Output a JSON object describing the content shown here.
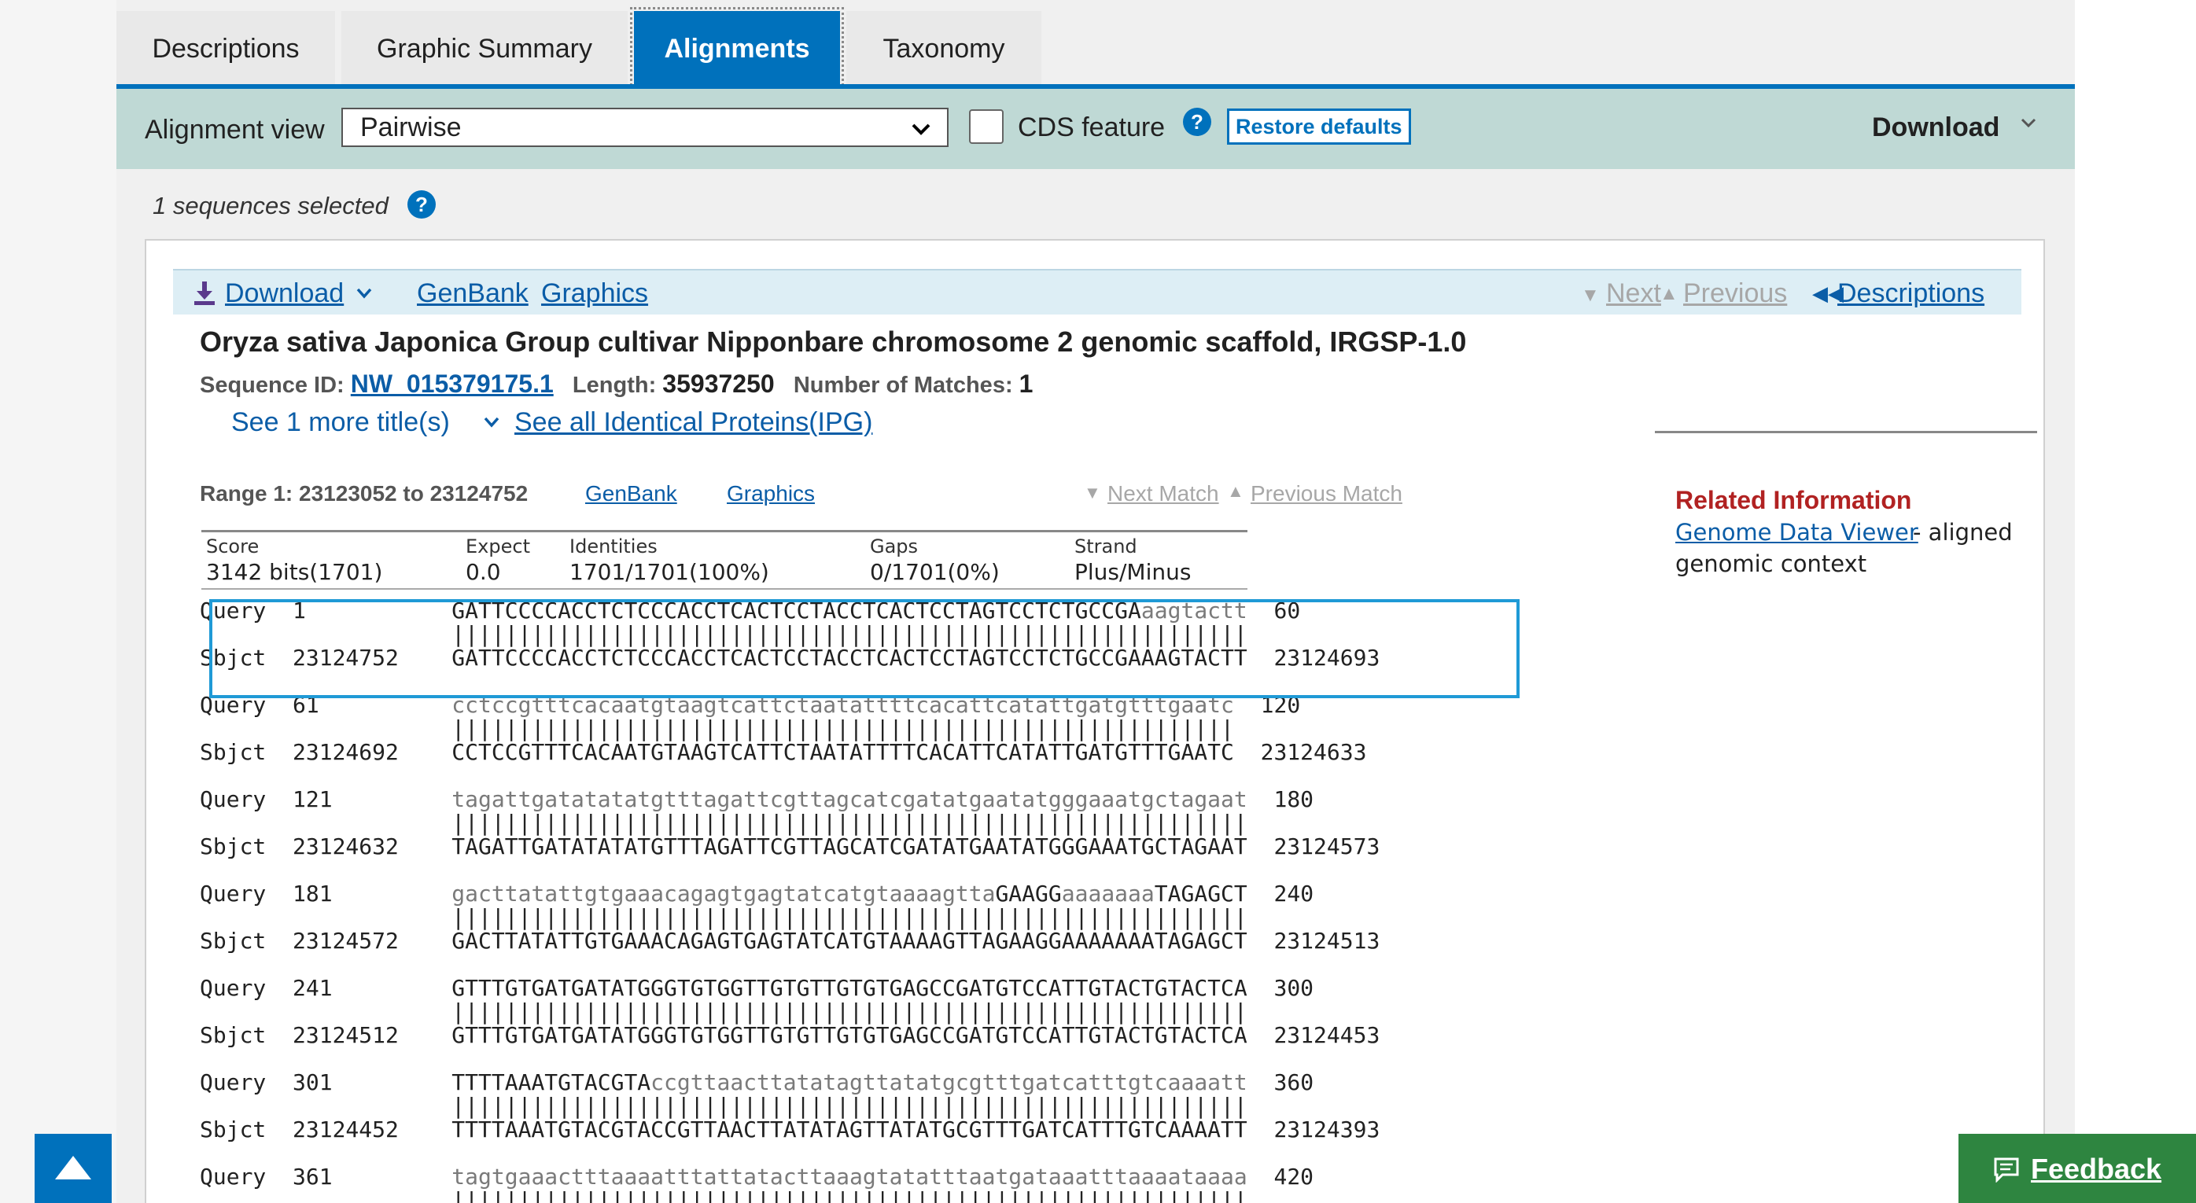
{
  "tabs": [
    {
      "label": "Descriptions"
    },
    {
      "label": "Graphic Summary"
    },
    {
      "label": "Alignments"
    },
    {
      "label": "Taxonomy"
    }
  ],
  "toolbar": {
    "alignment_view_label": "Alignment view",
    "alignment_view_value": "Pairwise",
    "cds_feature_label": "CDS feature",
    "restore_defaults_label": "Restore defaults",
    "download_label": "Download"
  },
  "selection": {
    "text": "1 sequences selected"
  },
  "panel_bar": {
    "download_label": "Download",
    "genbank_label": "GenBank",
    "graphics_label": "Graphics",
    "next_label": "Next",
    "previous_label": "Previous",
    "descriptions_label": "Descriptions"
  },
  "hit": {
    "title": "Oryza sativa Japonica Group cultivar Nipponbare chromosome 2 genomic scaffold, IRGSP-1.0",
    "sequence_id_label": "Sequence ID:",
    "sequence_id": "NW_015379175.1",
    "length_label": "Length:",
    "length": "35937250",
    "matches_label": "Number of Matches:",
    "matches": "1",
    "more_titles_label": "See 1 more title(s)",
    "ipg_label": "See all Identical Proteins(IPG)"
  },
  "range": {
    "text": "Range 1: 23123052 to 23124752",
    "genbank_label": "GenBank",
    "graphics_label": "Graphics",
    "next_match_label": "Next Match",
    "previous_match_label": "Previous Match"
  },
  "stats": {
    "score_label": "Score",
    "score": "3142 bits(1701)",
    "expect_label": "Expect",
    "expect": "0.0",
    "identities_label": "Identities",
    "identities": "1701/1701(100%)",
    "gaps_label": "Gaps",
    "gaps": "0/1701(0%)",
    "strand_label": "Strand",
    "strand": "Plus/Minus"
  },
  "related": {
    "title": "Related Information",
    "link_label": "Genome Data Viewer",
    "desc_line1": "- aligned",
    "desc_line2": "genomic context"
  },
  "alignment_rows": [
    {
      "q_start": "1",
      "q_seq": [
        [
          "GATTCCCCACCTCTCCCACCTCACTCCTACCTCACTCCTAGTCCTCTGCCGA",
          "uc"
        ],
        [
          "aagtactt",
          "lc"
        ]
      ],
      "q_end": "60",
      "s_start": "23124752",
      "s_seq": "GATTCCCCACCTCTCCCACCTCACTCCTACCTCACTCCTAGTCCTCTGCCGAAAGTACTT",
      "s_end": "23124693"
    },
    {
      "q_start": "61",
      "q_seq": [
        [
          "cctccgtttcacaatgtaagtcattctaatattttcacattcatattgatgtttgaatc",
          "lc"
        ]
      ],
      "q_end": "120",
      "s_start": "23124692",
      "s_seq": "CCTCCGTTTCACAATGTAAGTCATTCTAATATTTTCACATTCATATTGATGTTTGAATC",
      "s_end": "23124633"
    },
    {
      "q_start": "121",
      "q_seq": [
        [
          "tagattgatatatatgtttagattcgttagcatcgatatgaatatgggaaatgctagaat",
          "lc"
        ]
      ],
      "q_end": "180",
      "s_start": "23124632",
      "s_seq": "TAGATTGATATATATGTTTAGATTCGTTAGCATCGATATGAATATGGGAAATGCTAGAAT",
      "s_end": "23124573"
    },
    {
      "q_start": "181",
      "q_seq": [
        [
          "gacttatattgtgaaacagagtgagtatcatgtaaaagtta",
          "lc"
        ],
        [
          "GAAGG",
          "uc"
        ],
        [
          "aaaaaaa",
          "lc"
        ],
        [
          "TAGAGCT",
          "uc"
        ]
      ],
      "q_end": "240",
      "s_start": "23124572",
      "s_seq": "GACTTATATTGTGAAACAGAGTGAGTATCATGTAAAAGTTAGAAGGAAAAAAATAGAGCT",
      "s_end": "23124513"
    },
    {
      "q_start": "241",
      "q_seq": [
        [
          "GTTTGTGATGATATGGGTGTGGTTGTGTTGTGTGAGCCGATGTCCATTGTACTGTACTCA",
          "uc"
        ]
      ],
      "q_end": "300",
      "s_start": "23124512",
      "s_seq": "GTTTGTGATGATATGGGTGTGGTTGTGTTGTGTGAGCCGATGTCCATTGTACTGTACTCA",
      "s_end": "23124453"
    },
    {
      "q_start": "301",
      "q_seq": [
        [
          "TTTTAAATGTACGTA",
          "uc"
        ],
        [
          "ccgttaacttatatagttatatgcgtttgatcatttgtcaaaatt",
          "lc"
        ]
      ],
      "q_end": "360",
      "s_start": "23124452",
      "s_seq": "TTTTAAATGTACGTACCGTTAACTTATATAGTTATATGCGTTTGATCATTTGTCAAAATT",
      "s_end": "23124393"
    },
    {
      "q_start": "361",
      "q_seq": [
        [
          "tagtgaaactttaaaatttattatacttaaagtatatttaatgataaatttaaaataaaa",
          "lc"
        ]
      ],
      "q_end": "420",
      "s_start": "",
      "s_seq": "",
      "s_end": ""
    }
  ],
  "feedback": {
    "label": "Feedback"
  },
  "colors": {
    "accent": "#0071bc",
    "toolbar_bg": "#bfd9d5",
    "link": "#0b5da7",
    "related_title": "#b12222",
    "feedback_bg": "#2e8540",
    "highlight_border": "#1f9ad6"
  }
}
